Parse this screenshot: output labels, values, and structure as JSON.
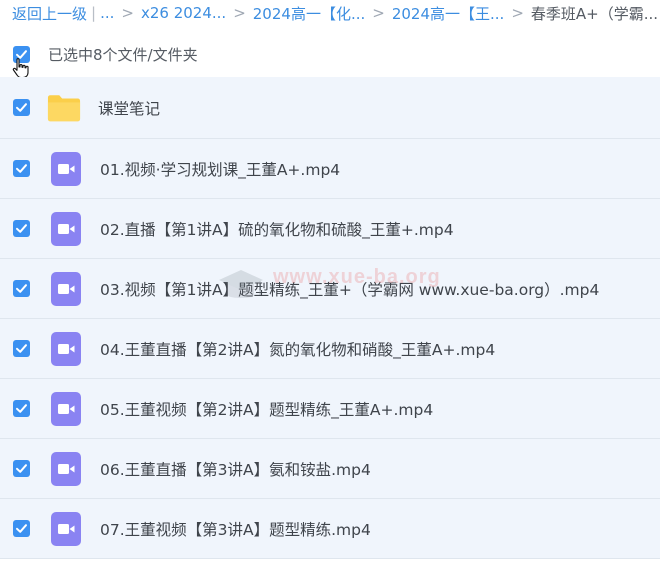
{
  "breadcrumb": {
    "back_label": "返回上一级",
    "ellipsis": "...",
    "items": [
      "x26 2024...",
      "2024高一【化...",
      "2024高一【王..."
    ],
    "current": "春季班A+（学霸..."
  },
  "selection": {
    "text": "已选中8个文件/文件夹"
  },
  "files": [
    {
      "name": "课堂笔记",
      "type": "folder",
      "icon": "folder-icon"
    },
    {
      "name": "01.视频·学习规划课_王董A+.mp4",
      "type": "video",
      "icon": "video-file-icon"
    },
    {
      "name": "02.直播【第1讲A】硫的氧化物和硫酸_王董+.mp4",
      "type": "video",
      "icon": "video-file-icon"
    },
    {
      "name": "03.视频【第1讲A】题型精练_王董+（学霸网 www.xue-ba.org）.mp4",
      "type": "video",
      "icon": "video-file-icon"
    },
    {
      "name": "04.王董直播【第2讲A】氮的氧化物和硝酸_王董A+.mp4",
      "type": "video",
      "icon": "video-file-icon"
    },
    {
      "name": "05.王董视频【第2讲A】题型精练_王董A+.mp4",
      "type": "video",
      "icon": "video-file-icon"
    },
    {
      "name": "06.王董直播【第3讲A】氨和铵盐.mp4",
      "type": "video",
      "icon": "video-file-icon"
    },
    {
      "name": "07.王董视频【第3讲A】题型精练.mp4",
      "type": "video",
      "icon": "video-file-icon"
    }
  ],
  "watermark": {
    "text": "www.xue-ba.org"
  },
  "colors": {
    "accent": "#3b91f1",
    "link": "#3c8de0",
    "row_bg": "#f0f5fc",
    "folder": "#fbcf4a",
    "video": "#8a83f2"
  }
}
